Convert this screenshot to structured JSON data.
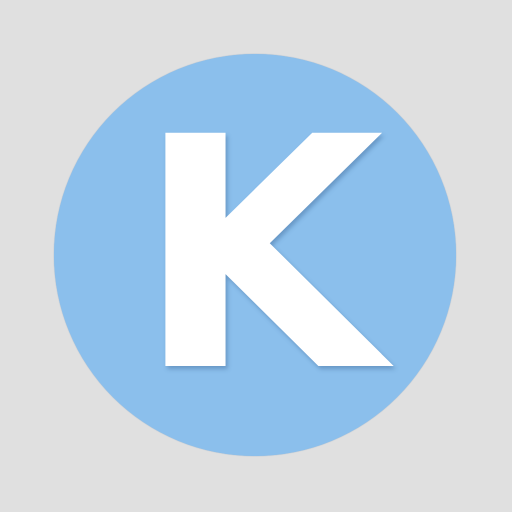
{
  "avatar": {
    "letter": "K",
    "background_color": "#8bbfec",
    "letter_color": "#ffffff"
  },
  "page": {
    "background_color": "#e0e0e0"
  }
}
